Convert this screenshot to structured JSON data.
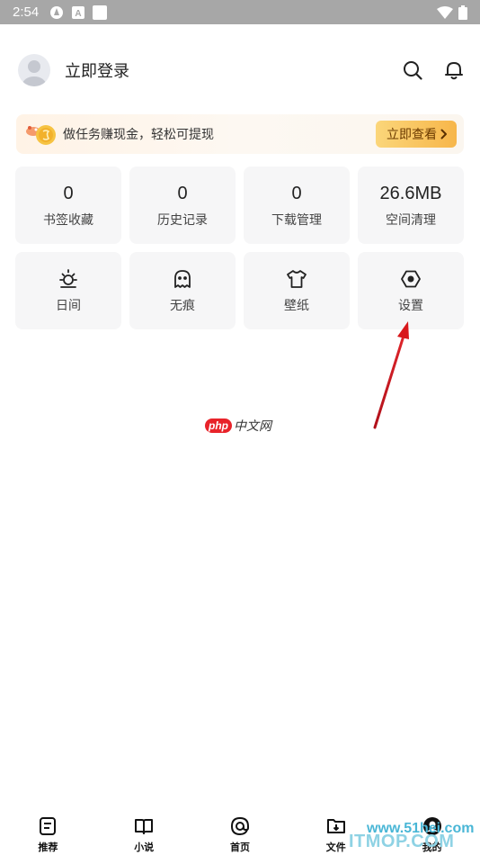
{
  "status_bar": {
    "time": "2:54"
  },
  "header": {
    "login_label": "立即登录"
  },
  "banner": {
    "text": "做任务赚现金，轻松可提现",
    "button_label": "立即查看"
  },
  "stats": [
    {
      "value": "0",
      "label": "书签收藏"
    },
    {
      "value": "0",
      "label": "历史记录"
    },
    {
      "value": "0",
      "label": "下载管理"
    },
    {
      "value": "26.6MB",
      "label": "空间清理"
    }
  ],
  "tools": [
    {
      "icon": "sun-icon",
      "label": "日间"
    },
    {
      "icon": "ghost-icon",
      "label": "无痕"
    },
    {
      "icon": "shirt-icon",
      "label": "壁纸"
    },
    {
      "icon": "settings-hexagon-icon",
      "label": "设置"
    }
  ],
  "watermark": {
    "php": "php",
    "cn": "中文网"
  },
  "bottom_nav": [
    {
      "icon": "document-icon",
      "label": "推荐"
    },
    {
      "icon": "book-icon",
      "label": "小说"
    },
    {
      "icon": "home-icon",
      "label": "首页"
    },
    {
      "icon": "folder-icon",
      "label": "文件"
    },
    {
      "icon": "user-icon",
      "label": "我的"
    }
  ],
  "corner_watermark": {
    "line1": "www.51hei.com",
    "line2": "ITMOP.COM"
  },
  "colors": {
    "accent_button": "#f7b64a",
    "arrow": "#d8171b",
    "tile_bg": "#f6f6f7"
  }
}
